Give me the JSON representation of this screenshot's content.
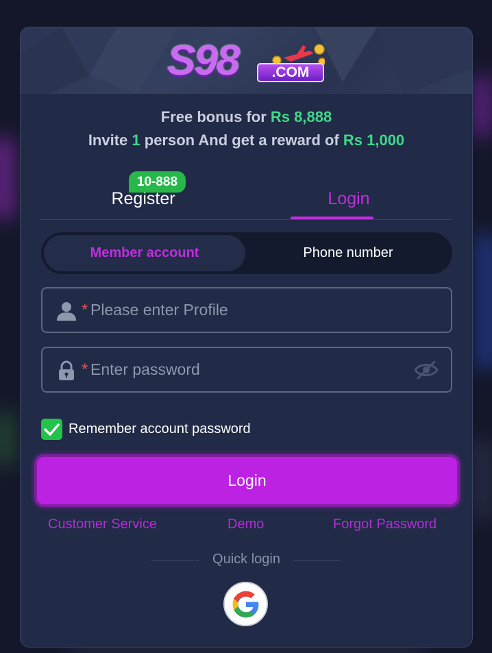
{
  "logo": {
    "brand_main": "S98",
    "brand_sub": ".COM"
  },
  "promo": {
    "line1_prefix": "Free bonus for ",
    "line1_amount": "Rs 8,888",
    "line2_prefix": "Invite ",
    "line2_count": "1",
    "line2_middle": " person And get a reward of ",
    "line2_amount": "Rs 1,000"
  },
  "tabs": {
    "register_label": "Register",
    "register_badge": "10-888",
    "login_label": "Login",
    "active": "login"
  },
  "account_type": {
    "member_label": "Member account",
    "phone_label": "Phone number",
    "selected": "member"
  },
  "fields": {
    "profile": {
      "required_mark": "*",
      "placeholder": "Please enter Profile",
      "value": ""
    },
    "password": {
      "required_mark": "*",
      "placeholder": "Enter password",
      "value": ""
    }
  },
  "remember": {
    "label": "Remember account password",
    "checked": true
  },
  "login_button": "Login",
  "links": {
    "customer_service": "Customer Service",
    "demo": "Demo",
    "forgot_password": "Forgot Password"
  },
  "quick_login": {
    "label": "Quick login",
    "providers": [
      "google-icon"
    ]
  },
  "colors": {
    "accent": "#c12ee0",
    "highlight_green": "#3ed88a",
    "badge_green": "#27b84a",
    "panel": "#212a46",
    "required": "#e0514f"
  }
}
